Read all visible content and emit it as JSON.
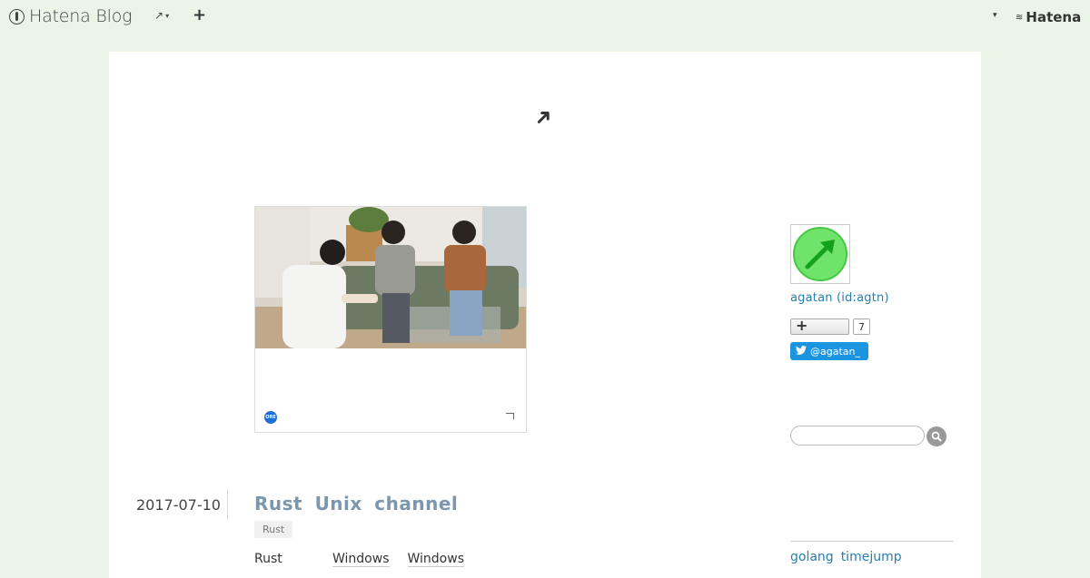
{
  "topbar": {
    "logo_text": "Hatena Blog",
    "menu_glyph": "↗",
    "menu_caret": "▾",
    "add_glyph": "+",
    "right_caret": "▾",
    "hatena_text": "Hatena"
  },
  "embed": {
    "badge_text": "ORE"
  },
  "article": {
    "date": "2017-07-10",
    "title": "Rust  Unix  channel",
    "tag": "Rust",
    "body_word1": "Rust",
    "body_link1": "Windows",
    "body_link2": "Windows"
  },
  "sidebar": {
    "author": "agatan (id:agtn)",
    "subscribe_plus": "+",
    "subscribe_count": "7",
    "twitter_handle": "@agatan_",
    "links": [
      "golang",
      "timejump"
    ]
  },
  "colors": {
    "background": "#eaf5e8",
    "link": "#2a7dad",
    "title": "#7b96ad",
    "twitter": "#1b95e0",
    "avatar_green": "#6fe36b"
  }
}
